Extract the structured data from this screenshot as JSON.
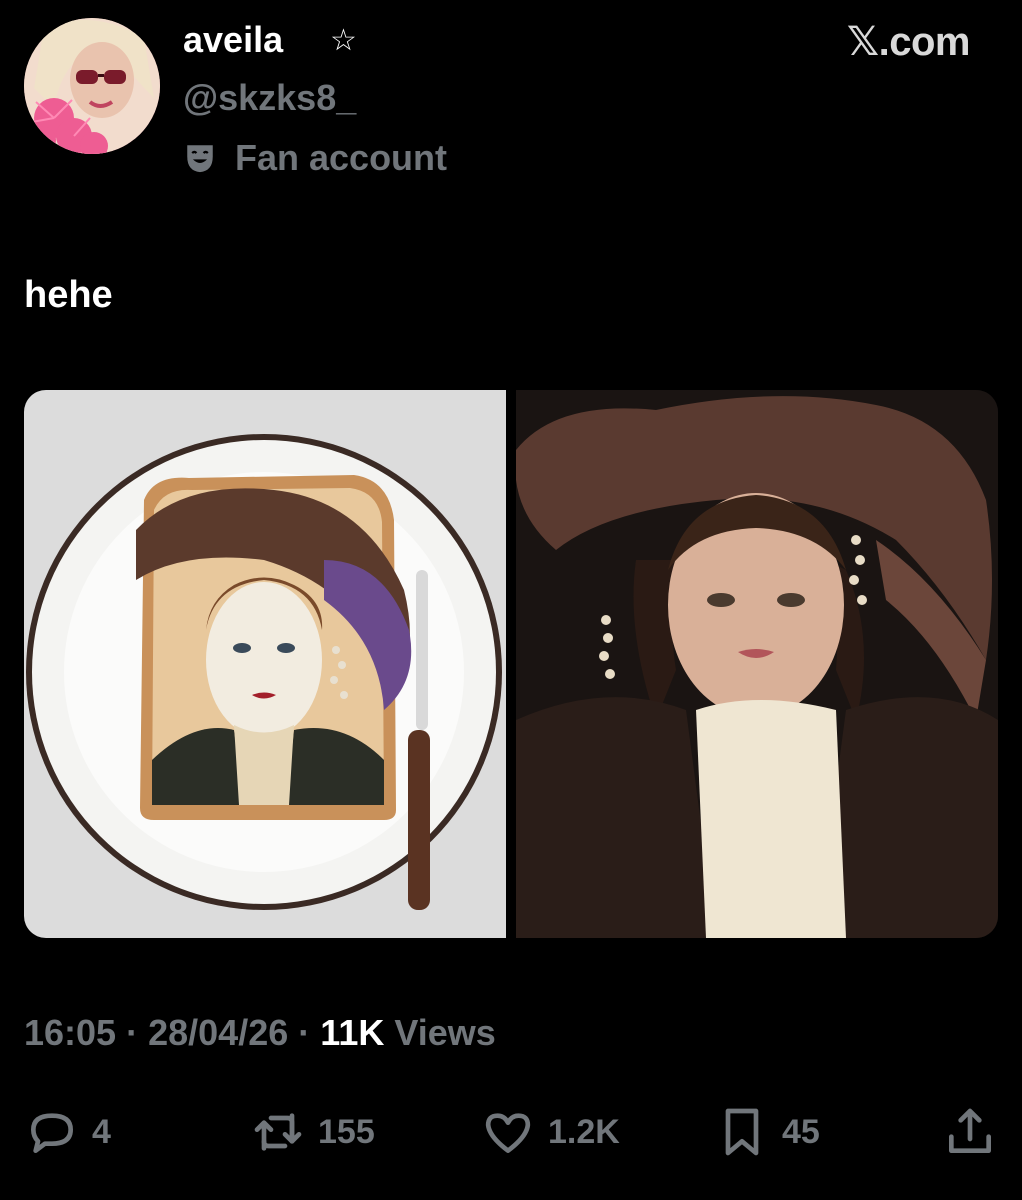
{
  "header": {
    "display_name": "aveila",
    "star_icon": "☆",
    "handle": "@skzks8_",
    "badge_icon": "theater-mask-icon",
    "badge_label": "Fan account",
    "brand": "𝕏.com"
  },
  "tweet": {
    "text": "hehe",
    "media": [
      "toast-portrait-photo",
      "model-portrait-photo"
    ]
  },
  "meta": {
    "time": "16:05",
    "date": "28/04/26",
    "sep": "·",
    "views_count": "11K",
    "views_label": "Views"
  },
  "actions": {
    "reply_count": "4",
    "retweet_count": "155",
    "like_count": "1.2K",
    "bookmark_count": "45"
  },
  "colors": {
    "background": "#000000",
    "primary_text": "#ffffff",
    "secondary_text": "#71767b"
  }
}
